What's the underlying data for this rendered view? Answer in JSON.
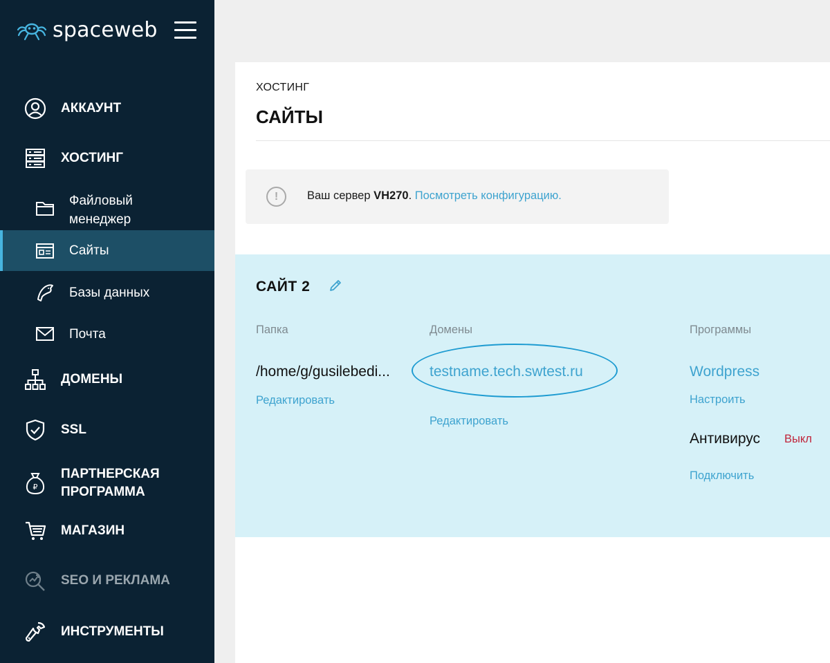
{
  "brand": {
    "name": "spaceweb"
  },
  "sidebar": {
    "account": "АККАУНТ",
    "hosting": "ХОСТИНГ",
    "sub": {
      "file_manager_1": "Файловый",
      "file_manager_2": "менеджер",
      "sites": "Сайты",
      "databases": "Базы данных",
      "mail": "Почта"
    },
    "domains": "ДОМЕНЫ",
    "ssl": "SSL",
    "partner_1": "ПАРТНЕРСКАЯ",
    "partner_2": "ПРОГРАММА",
    "shop": "МАГАЗИН",
    "seo": "SEO И РЕКЛАМА",
    "tools": "ИНСТРУМЕНТЫ"
  },
  "header": {
    "breadcrumb": "ХОСТИНГ",
    "title": "САЙТЫ"
  },
  "notice": {
    "prefix": "Ваш сервер ",
    "server": "VH270",
    "dot": ". ",
    "link": "Посмотреть конфигурацию."
  },
  "site": {
    "title": "САЙТ 2",
    "folder_header": "Папка",
    "folder_value": "/home/g/gusilebedi...",
    "folder_edit": "Редактировать",
    "domains_header": "Домены",
    "domain_value": "testname.tech.swtest.ru",
    "domain_edit": "Редактировать",
    "programs_header": "Программы",
    "program_value": "Wordpress",
    "program_setup": "Настроить",
    "antivirus_label": "Антивирус",
    "antivirus_status": "Выкл",
    "antivirus_connect": "Подключить"
  },
  "colors": {
    "sidebar_bg": "#0b2233",
    "sidebar_active": "#1d4f66",
    "accent": "#3ea3cf",
    "card_bg": "#d6f1f8",
    "status_off": "#c0253b"
  }
}
